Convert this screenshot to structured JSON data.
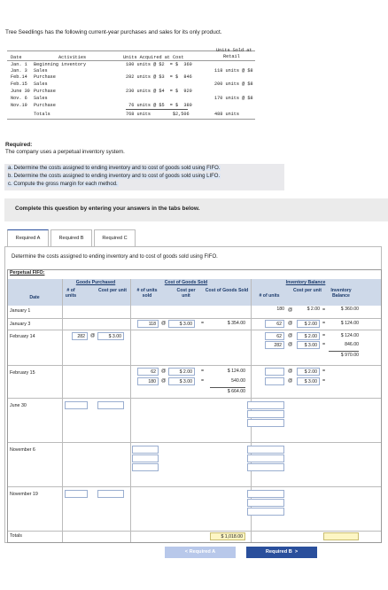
{
  "intro": "Tree Seedlings has the following current-year purchases and sales for its only product.",
  "data_table": {
    "header_date": "Date",
    "header_activities": "Activities",
    "header_units_cost": "Units Acquired at Cost",
    "header_units_sold_1": "Units Sold at",
    "header_units_sold_2": "Retail",
    "rows": [
      {
        "date": "Jan. 1",
        "activity": "Beginning inventory",
        "acq": "180 units @ $2  = $  360",
        "sold": ""
      },
      {
        "date": "Jan. 3",
        "activity": "Sales",
        "acq": "",
        "sold": "118 units @ $8"
      },
      {
        "date": "Feb.14",
        "activity": "Purchase",
        "acq": "282 units @ $3  = $  846",
        "sold": ""
      },
      {
        "date": "Feb.15",
        "activity": "Sales",
        "acq": "",
        "sold": "200 units @ $8"
      },
      {
        "date": "June 30",
        "activity": "Purchase",
        "acq": "230 units @ $4  = $  920",
        "sold": ""
      },
      {
        "date": "Nov. 6",
        "activity": "Sales",
        "acq": "",
        "sold": "170 units @ $8"
      },
      {
        "date": "Nov.19",
        "activity": "Purchase",
        "acq": " 76 units @ $5  = $  380",
        "sold": ""
      },
      {
        "date": "",
        "activity": "Totals",
        "acq": "768 units        $2,506",
        "sold": "488 units"
      }
    ]
  },
  "required_title": "Required:",
  "required_sub": "The company uses a perpetual inventory system.",
  "questions": [
    "a. Determine the costs assigned to ending inventory and to cost of goods sold using FIFO.",
    "b. Determine the costs assigned to ending inventory and to cost of goods sold using LIFO.",
    "c. Compute the gross margin for each method."
  ],
  "complete_text": "Complete this question by entering your answers in the tabs below.",
  "tabs": [
    "Required A",
    "Required B",
    "Required C"
  ],
  "instruction": "Determine the costs assigned to ending inventory and to cost of goods sold using FIFO.",
  "fifo": {
    "title": "Perpetual FIFO:",
    "group_purchased": "Goods Purchased",
    "group_cogs": "Cost of Goods Sold",
    "group_inv": "Inventory Balance",
    "col_date": "Date",
    "col_units": "# of units",
    "col_cost_per_unit": "Cost per unit",
    "col_units_sold": "# of units sold",
    "col_cogs": "Cost of Goods Sold",
    "col_inv_balance": "Inventory Balance",
    "at": "@",
    "eq": "=",
    "dates": [
      "January 1",
      "January 3",
      "February 14",
      "February 15",
      "June 30",
      "November 6",
      "November 19",
      "Totals"
    ],
    "jan1": {
      "inv_units": "180",
      "inv_cost": "$ 2.00",
      "inv_bal": "$  360.00"
    },
    "jan3": {
      "sold_units": "118",
      "sold_cost": "$ 3.00",
      "cogs": "$  354.00",
      "inv_units": "62",
      "inv_cost": "$ 2.00",
      "inv_bal": "$  124.00"
    },
    "feb14": {
      "p_units": "282",
      "p_cost": "$  3.00",
      "inv_units_1": "62",
      "inv_cost_1": "$ 2.00",
      "inv_bal_1": "$  124.00",
      "inv_units_2": "282",
      "inv_cost_2": "$ 3.00",
      "inv_bal_2": "846.00",
      "inv_total": "$  970.00"
    },
    "feb15": {
      "sold_units_1": "62",
      "sold_cost_1": "$ 2.00",
      "cogs_1": "$  124.00",
      "sold_units_2": "180",
      "sold_cost_2": "$ 3.00",
      "cogs_2": "540.00",
      "cogs_total": "$  664.00",
      "inv_cost_1": "$ 2.00",
      "inv_cost_2": "$ 3.00"
    },
    "totals": {
      "cogs": "$ 1,018.00"
    }
  },
  "nav": {
    "prev": "Required A",
    "next": "Required B"
  }
}
